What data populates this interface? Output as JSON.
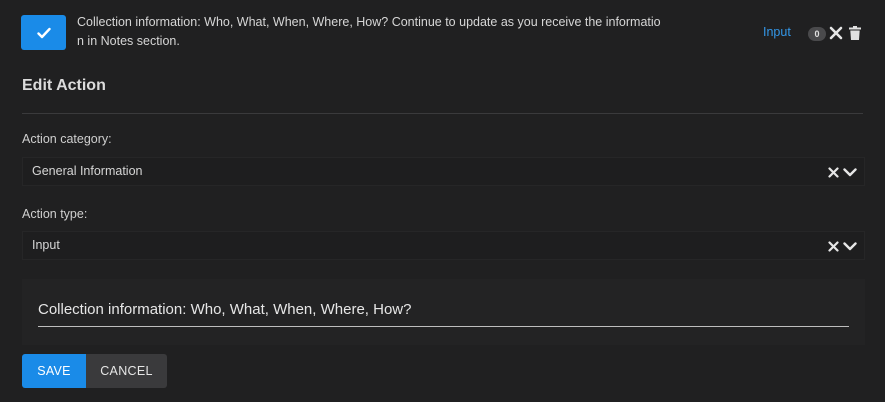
{
  "action": {
    "checked": true,
    "description": "Collection information: Who, What, When, Where, How? Continue to update as you receive the information in Notes section.",
    "type_link": "Input",
    "count": "0",
    "accent_color": "#1a8be8"
  },
  "edit": {
    "title": "Edit Action",
    "category_label": "Action category:",
    "category_value": "General Information",
    "type_label": "Action type:",
    "type_value": "Input",
    "text_value": "Collection information: Who, What, When, Where, How?",
    "save_label": "SAVE",
    "cancel_label": "CANCEL"
  },
  "icons": {
    "check": "check-icon",
    "close": "close-icon",
    "trash": "trash-icon",
    "chevron": "chevron-down-icon"
  }
}
